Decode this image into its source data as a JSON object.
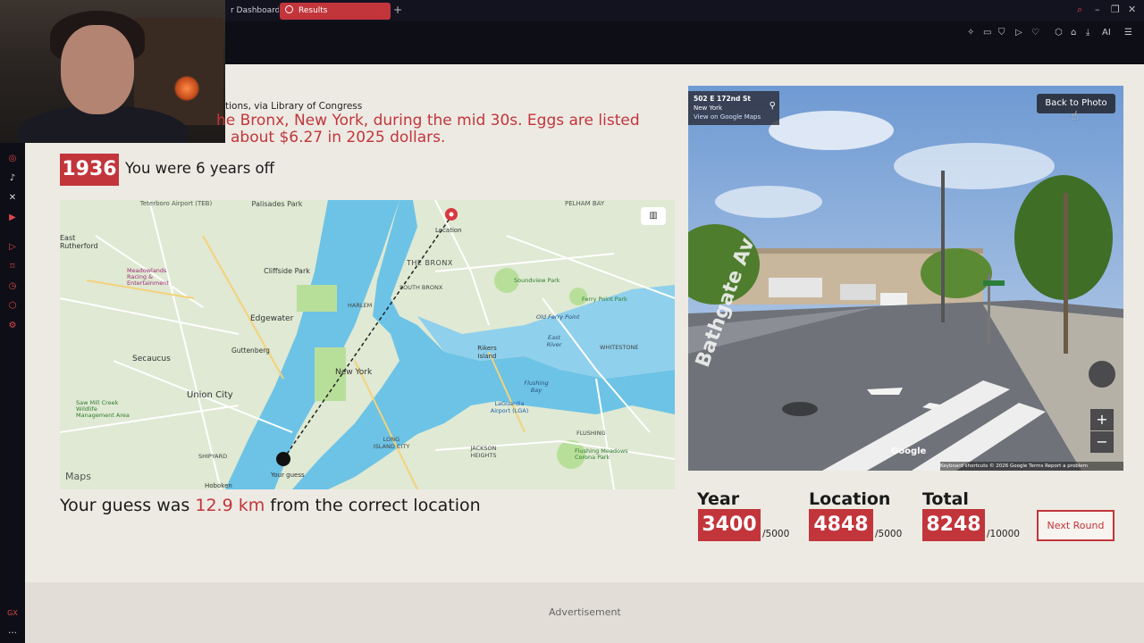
{
  "browser": {
    "tabs": [
      {
        "label": "r Dashboard"
      },
      {
        "label": "Results"
      }
    ],
    "new_tab": "+",
    "toolbar_ai": "AI"
  },
  "round": {
    "caption_source": "tions, via Library of Congress",
    "caption_line1": "he Bronx, New York, during the mid 30s. Eggs are listed",
    "caption_line2": "about $6.27 in 2025 dollars.",
    "year": "1936",
    "year_result": "You were 6 years off",
    "guess_prefix": "Your guess was",
    "guess_distance": "12.9 km",
    "guess_suffix": "from the correct location"
  },
  "map": {
    "labels": {
      "teterboro": "Teterboro Airport (TEB)",
      "palisades": "Palisades Park",
      "pelham": "PELHAM BAY",
      "east_rutherford": "East Rutherford",
      "cliffside": "Cliffside Park",
      "the_bronx": "THE BRONX",
      "meadowlands": "Meadowlands Racing & Entertainment",
      "south_bronx": "SOUTH BRONX",
      "soundview": "Soundview Park",
      "ferry_point": "Ferry Point Park",
      "edgewater": "Edgewater",
      "harlem": "HARLEM",
      "old_ferry": "Old Ferry Point",
      "guttenberg": "Guttenberg",
      "whitestone": "WHITESTONE",
      "secaucus": "Secaucus",
      "new_york": "New York",
      "rikers": "Rikers Island",
      "east_river": "East River",
      "union_city": "Union City",
      "flushing_bay": "Flushing Bay",
      "laguardia": "LaGuardia Airport (LGA)",
      "sawmill": "Saw Mill Creek Wildlife Management Area",
      "flushing": "FLUSHING",
      "long_island_city": "LONG ISLAND CITY",
      "jackson": "JACKSON HEIGHTS",
      "shipyard": "SHIPYARD",
      "flushing_meadows": "Flushing Meadows Corona Park",
      "location": "Location",
      "your_guess": "Your guess",
      "maps_brand": "Maps",
      "hoboken": "Hoboken"
    }
  },
  "streetview": {
    "street": "502 E 172nd St",
    "city": "New York",
    "link": "View on Google Maps",
    "back_button": "Back to Photo",
    "zoom_in": "+",
    "zoom_out": "−",
    "brand": "Google",
    "footer": "Keyboard shortcuts   © 2026 Google   Terms   Report a problem",
    "street_sign": "Bathgate Av"
  },
  "scores": [
    {
      "label": "Year",
      "value": "3400",
      "max": "/5000"
    },
    {
      "label": "Location",
      "value": "4848",
      "max": "/5000"
    },
    {
      "label": "Total",
      "value": "8248",
      "max": "/10000"
    }
  ],
  "next_button": "Next Round",
  "advertisement": "Advertisement",
  "colors": {
    "accent": "#c2353b",
    "page_bg": "#edeae3",
    "chrome_bg": "#131320"
  },
  "icons": {
    "sidebar": [
      "instagram-icon",
      "tiktok-icon",
      "x-icon",
      "youtube-icon",
      "play-icon",
      "bookmark-icon",
      "clock-icon",
      "extension-icon",
      "settings-icon"
    ]
  }
}
